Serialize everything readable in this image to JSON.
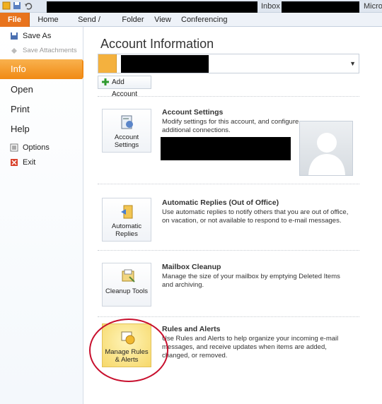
{
  "titlebar": {
    "title_partial": "Inbox -",
    "title_right": "Micros"
  },
  "ribbon_tabs": [
    {
      "label": "File"
    },
    {
      "label": "Home"
    },
    {
      "label": "Send / Receive"
    },
    {
      "label": "Folder"
    },
    {
      "label": "View"
    },
    {
      "label": "Conferencing"
    }
  ],
  "backstage": {
    "items": {
      "save_as": "Save As",
      "save_attachments": "Save Attachments",
      "info": "Info",
      "open": "Open",
      "print": "Print",
      "help": "Help",
      "options": "Options",
      "exit": "Exit"
    }
  },
  "main": {
    "title": "Account Information",
    "add_account": "Add Account",
    "sections": {
      "account_settings": {
        "button": "Account Settings",
        "title": "Account Settings",
        "desc": "Modify settings for this account, and configure additional connections."
      },
      "automatic_replies": {
        "button": "Automatic Replies",
        "title": "Automatic Replies (Out of Office)",
        "desc": "Use automatic replies to notify others that you are out of office, on vacation, or not available to respond to e-mail messages."
      },
      "mailbox_cleanup": {
        "button": "Cleanup Tools",
        "title": "Mailbox Cleanup",
        "desc": "Manage the size of your mailbox by emptying Deleted Items and archiving."
      },
      "rules_alerts": {
        "button": "Manage Rules & Alerts",
        "title": "Rules and Alerts",
        "desc": "Use Rules and Alerts to help organize your incoming e-mail messages, and receive updates when items are added, changed, or removed."
      }
    }
  },
  "colors": {
    "file_tab": "#e8731d",
    "info_highlight": "#f08a15",
    "circle_annotation": "#c8102e"
  }
}
